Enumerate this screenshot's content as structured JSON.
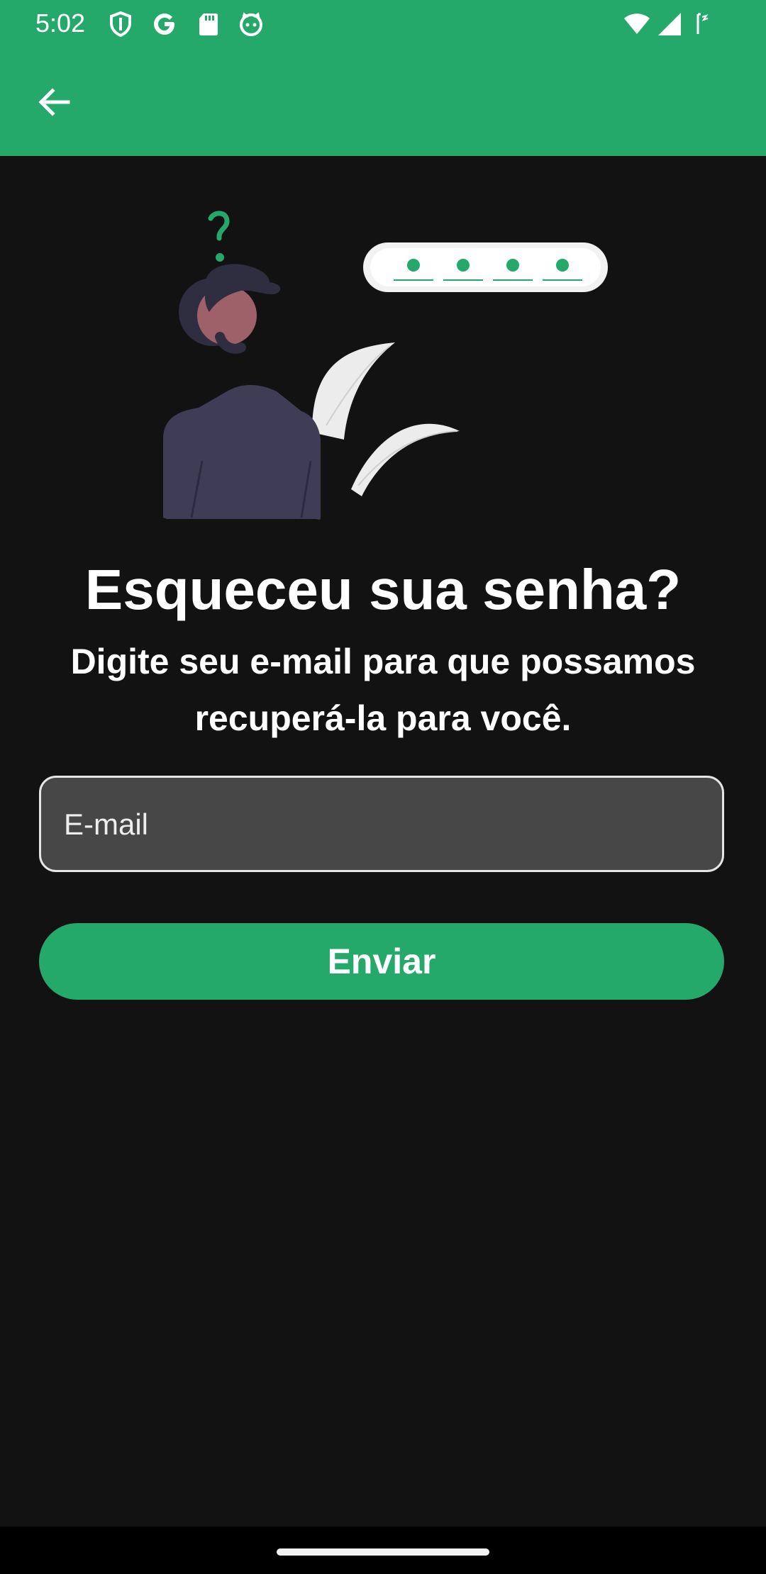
{
  "status_bar": {
    "time": "5:02",
    "left_icons": [
      "shield-icon",
      "google-icon",
      "sd-card-icon",
      "cat-icon"
    ],
    "right_icons": [
      "wifi-icon",
      "cell-signal-icon",
      "battery-icon"
    ]
  },
  "app_bar": {
    "back_icon": "arrow-left-icon"
  },
  "illustration": {
    "description_icon": "forgot-password-illustration"
  },
  "main": {
    "title": "Esqueceu sua senha?",
    "subtitle": "Digite seu e-mail para que possamos recuperá-la para você.",
    "email_field": {
      "placeholder": "E-mail",
      "value": ""
    },
    "submit_label": "Enviar"
  },
  "colors": {
    "primary": "#25a96a",
    "background": "#121212",
    "input_background": "#474747"
  }
}
